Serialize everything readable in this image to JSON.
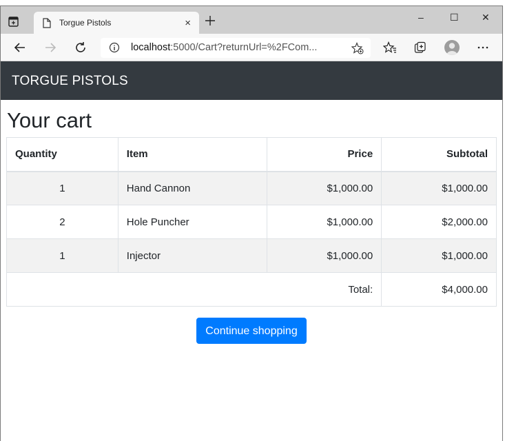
{
  "browser": {
    "tab_title": "Torgue Pistols",
    "tab_close": "×",
    "new_tab": "+",
    "url_host": "localhost",
    "url_rest": ":5000/Cart?returnUrl=%2FCom..."
  },
  "window_controls": {
    "minimize": "–",
    "maximize": "☐",
    "close": "✕"
  },
  "navbar": {
    "brand": "TORGUE PISTOLS"
  },
  "page": {
    "title": "Your cart"
  },
  "cart": {
    "headers": {
      "quantity": "Quantity",
      "item": "Item",
      "price": "Price",
      "subtotal": "Subtotal"
    },
    "rows": [
      {
        "quantity": "1",
        "item": "Hand Cannon",
        "price": "$1,000.00",
        "subtotal": "$1,000.00"
      },
      {
        "quantity": "2",
        "item": "Hole Puncher",
        "price": "$1,000.00",
        "subtotal": "$2,000.00"
      },
      {
        "quantity": "1",
        "item": "Injector",
        "price": "$1,000.00",
        "subtotal": "$1,000.00"
      }
    ],
    "total_label": "Total:",
    "total_value": "$4,000.00"
  },
  "actions": {
    "continue_label": "Continue shopping"
  },
  "colors": {
    "navbar": "#343a40",
    "primary": "#007bff",
    "stripe": "#f2f2f2"
  }
}
